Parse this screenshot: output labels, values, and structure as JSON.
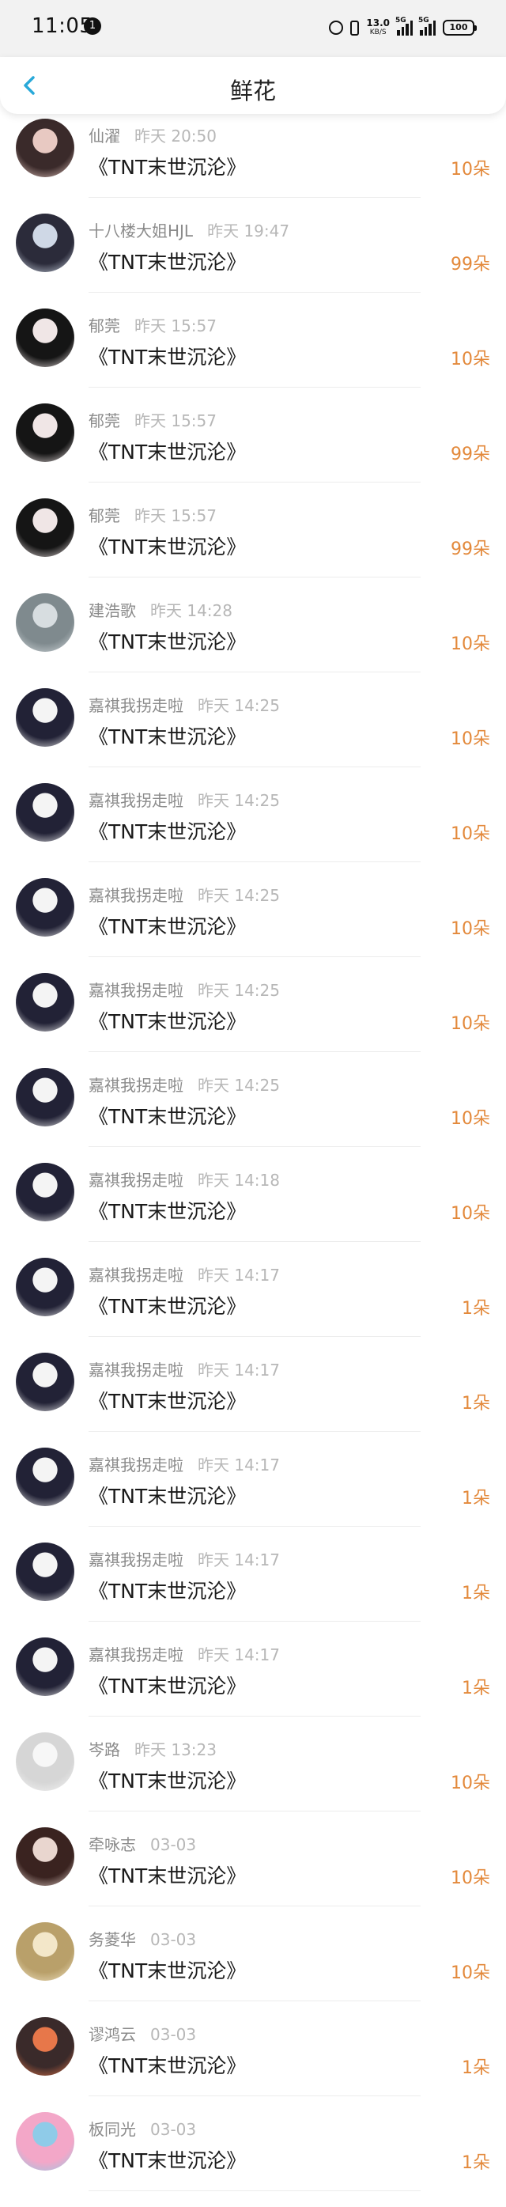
{
  "status_bar": {
    "time": "11:05",
    "notification_count": "1",
    "net_speed_value": "13.0",
    "net_speed_unit": "KB/S",
    "signal1_label": "5G",
    "signal2_label": "5G",
    "battery": "100"
  },
  "nav": {
    "title": "鲜花"
  },
  "colors": {
    "accent": "#29a9d9",
    "count": "#e3893b"
  },
  "rows": [
    {
      "name": "仙濯",
      "time": "昨天 20:50",
      "title": "《TNT末世沉沦》",
      "count": "10朵",
      "avatar_colors": [
        "#e8c9c2",
        "#3a2a2a"
      ]
    },
    {
      "name": "十八楼大姐HJL",
      "time": "昨天 19:47",
      "title": "《TNT末世沉沦》",
      "count": "99朵",
      "avatar_colors": [
        "#cfd8e6",
        "#2b2b3a"
      ]
    },
    {
      "name": "郁莞",
      "time": "昨天 15:57",
      "title": "《TNT末世沉沦》",
      "count": "10朵",
      "avatar_colors": [
        "#f0e6e6",
        "#151515"
      ]
    },
    {
      "name": "郁莞",
      "time": "昨天 15:57",
      "title": "《TNT末世沉沦》",
      "count": "99朵",
      "avatar_colors": [
        "#f0e6e6",
        "#151515"
      ]
    },
    {
      "name": "郁莞",
      "time": "昨天 15:57",
      "title": "《TNT末世沉沦》",
      "count": "99朵",
      "avatar_colors": [
        "#f0e6e6",
        "#151515"
      ]
    },
    {
      "name": "建浩歌",
      "time": "昨天 14:28",
      "title": "《TNT末世沉沦》",
      "count": "10朵",
      "avatar_colors": [
        "#d7dde0",
        "#7f8a8e"
      ]
    },
    {
      "name": "嘉祺我拐走啦",
      "time": "昨天 14:25",
      "title": "《TNT末世沉沦》",
      "count": "10朵",
      "avatar_colors": [
        "#f4f4f4",
        "#222236"
      ]
    },
    {
      "name": "嘉祺我拐走啦",
      "time": "昨天 14:25",
      "title": "《TNT末世沉沦》",
      "count": "10朵",
      "avatar_colors": [
        "#f4f4f4",
        "#222236"
      ]
    },
    {
      "name": "嘉祺我拐走啦",
      "time": "昨天 14:25",
      "title": "《TNT末世沉沦》",
      "count": "10朵",
      "avatar_colors": [
        "#f4f4f4",
        "#222236"
      ]
    },
    {
      "name": "嘉祺我拐走啦",
      "time": "昨天 14:25",
      "title": "《TNT末世沉沦》",
      "count": "10朵",
      "avatar_colors": [
        "#f4f4f4",
        "#222236"
      ]
    },
    {
      "name": "嘉祺我拐走啦",
      "time": "昨天 14:25",
      "title": "《TNT末世沉沦》",
      "count": "10朵",
      "avatar_colors": [
        "#f4f4f4",
        "#222236"
      ]
    },
    {
      "name": "嘉祺我拐走啦",
      "time": "昨天 14:18",
      "title": "《TNT末世沉沦》",
      "count": "10朵",
      "avatar_colors": [
        "#f4f4f4",
        "#222236"
      ]
    },
    {
      "name": "嘉祺我拐走啦",
      "time": "昨天 14:17",
      "title": "《TNT末世沉沦》",
      "count": "1朵",
      "avatar_colors": [
        "#f4f4f4",
        "#222236"
      ]
    },
    {
      "name": "嘉祺我拐走啦",
      "time": "昨天 14:17",
      "title": "《TNT末世沉沦》",
      "count": "1朵",
      "avatar_colors": [
        "#f4f4f4",
        "#222236"
      ]
    },
    {
      "name": "嘉祺我拐走啦",
      "time": "昨天 14:17",
      "title": "《TNT末世沉沦》",
      "count": "1朵",
      "avatar_colors": [
        "#f4f4f4",
        "#222236"
      ]
    },
    {
      "name": "嘉祺我拐走啦",
      "time": "昨天 14:17",
      "title": "《TNT末世沉沦》",
      "count": "1朵",
      "avatar_colors": [
        "#f4f4f4",
        "#222236"
      ]
    },
    {
      "name": "嘉祺我拐走啦",
      "time": "昨天 14:17",
      "title": "《TNT末世沉沦》",
      "count": "1朵",
      "avatar_colors": [
        "#f4f4f4",
        "#222236"
      ]
    },
    {
      "name": "岑路",
      "time": "昨天 13:23",
      "title": "《TNT末世沉沦》",
      "count": "10朵",
      "avatar_colors": [
        "#f7f7f7",
        "#d6d6d6"
      ]
    },
    {
      "name": "牵咏志",
      "time": "03-03",
      "title": "《TNT末世沉沦》",
      "count": "10朵",
      "avatar_colors": [
        "#e9d6cf",
        "#3a2320"
      ]
    },
    {
      "name": "务菱华",
      "time": "03-03",
      "title": "《TNT末世沉沦》",
      "count": "10朵",
      "avatar_colors": [
        "#f3e7c9",
        "#b9a06a"
      ]
    },
    {
      "name": "谬鸿云",
      "time": "03-03",
      "title": "《TNT末世沉沦》",
      "count": "1朵",
      "avatar_colors": [
        "#e7774a",
        "#3a2a2a"
      ]
    },
    {
      "name": "板同光",
      "time": "03-03",
      "title": "《TNT末世沉沦》",
      "count": "1朵",
      "avatar_colors": [
        "#8fcbe8",
        "#f3a7c8"
      ]
    }
  ]
}
